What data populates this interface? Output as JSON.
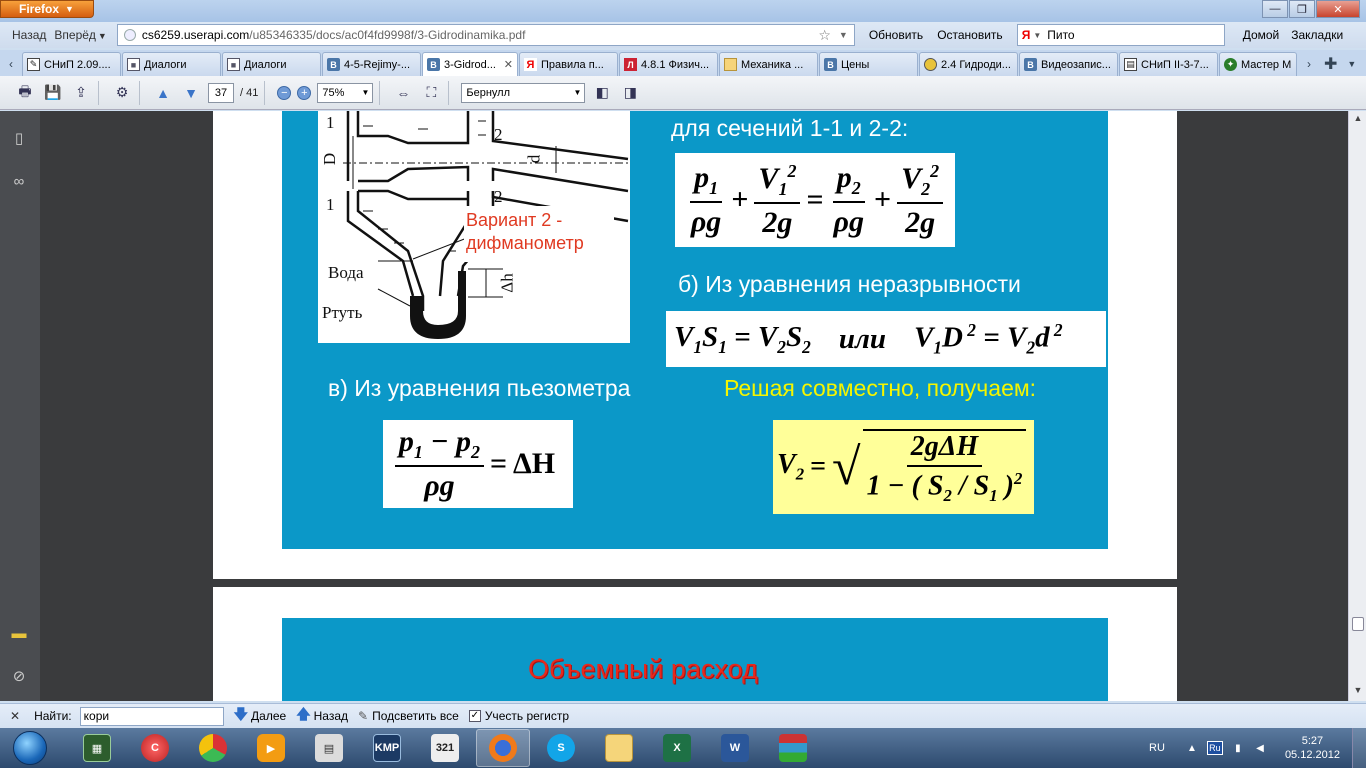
{
  "browser": {
    "menu_button": "Firefox",
    "nav": {
      "back": "Назад",
      "forward": "Вперёд",
      "url_host": "cs6259.userapi.com",
      "url_path": "/u85346335/docs/ac0f4fd9998f/3-Gidrodinamika.pdf",
      "refresh": "Обновить",
      "stop": "Остановить",
      "search_value": "Пито",
      "home": "Домой",
      "bookmarks": "Закладки"
    },
    "tabs": [
      {
        "label": "СНиП 2.09....",
        "icon": "pdf-icon"
      },
      {
        "label": "Диалоги",
        "icon": "dialog-icon"
      },
      {
        "label": "Диалоги",
        "icon": "dialog-icon"
      },
      {
        "label": "4-5-Rejimy-...",
        "icon": "vk-icon"
      },
      {
        "label": "3-Gidrod...",
        "icon": "vk-icon",
        "active": true
      },
      {
        "label": "Правила п...",
        "icon": "yandex-icon"
      },
      {
        "label": "4.8.1 Физич...",
        "icon": "l-icon"
      },
      {
        "label": "Механика ...",
        "icon": "folder-icon"
      },
      {
        "label": "Цены",
        "icon": "vk-icon"
      },
      {
        "label": "2.4 Гидроди...",
        "icon": "globe-icon"
      },
      {
        "label": "Видеозапис...",
        "icon": "vk-icon"
      },
      {
        "label": "СНиП II-3-7...",
        "icon": "page-icon"
      },
      {
        "label": "Мастер М",
        "icon": "master-icon"
      }
    ]
  },
  "pdf_toolbar": {
    "page_current": "37",
    "page_total": "/ 41",
    "zoom": "75%",
    "find_text": "Бернулл"
  },
  "slide1": {
    "diagram_labels": {
      "l1_top": "1",
      "l1_bottom": "1",
      "l2_top": "2",
      "l2_bottom": "2",
      "D": "D",
      "d": "d",
      "dh": "Δh",
      "water": "Вода",
      "mercury": "Ртуть"
    },
    "variant_line1": "Вариант 2 -",
    "variant_line2": "дифманометр",
    "bernoulli_caption": "для сечений 1-1 и 2-2:",
    "continuity_caption": "б) Из уравнения неразрывности",
    "continuity_or": "или",
    "piezo_caption": "в) Из уравнения пьезометра",
    "solve_caption": "Решая совместно, получаем:",
    "colors": {
      "slide_bg": "#0b98c8",
      "caption_yellow": "#f5f500",
      "variant_red": "#e03a22",
      "result_bg": "#ffff99"
    }
  },
  "slide2": {
    "title": "Объемный расход"
  },
  "findbar": {
    "label": "Найти:",
    "value": "кори",
    "next": "Далее",
    "prev": "Назад",
    "highlight": "Подсветить все",
    "match_case": "Учесть регистр"
  },
  "taskbar": {
    "lang": "RU",
    "lang_box": "Ru",
    "time": "5:27",
    "date": "05.12.2012"
  }
}
